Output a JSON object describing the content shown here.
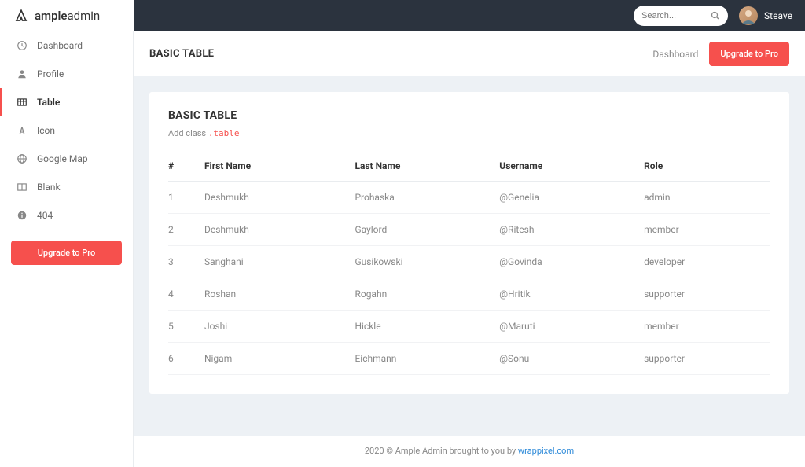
{
  "brand": {
    "name_bold": "ample",
    "name_light": "admin"
  },
  "search": {
    "placeholder": "Search..."
  },
  "user": {
    "name": "Steave"
  },
  "sidebar": {
    "items": [
      {
        "label": "Dashboard",
        "icon": "clock"
      },
      {
        "label": "Profile",
        "icon": "user"
      },
      {
        "label": "Table",
        "icon": "table",
        "active": true
      },
      {
        "label": "Icon",
        "icon": "font"
      },
      {
        "label": "Google Map",
        "icon": "globe"
      },
      {
        "label": "Blank",
        "icon": "columns"
      },
      {
        "label": "404",
        "icon": "info"
      }
    ],
    "upgrade_label": "Upgrade to Pro"
  },
  "header": {
    "title": "BASIC TABLE",
    "breadcrumb": "Dashboard",
    "upgrade_label": "Upgrade to Pro"
  },
  "card": {
    "title": "BASIC TABLE",
    "sub_prefix": "Add class ",
    "sub_code": ".table"
  },
  "table": {
    "columns": [
      "#",
      "First Name",
      "Last Name",
      "Username",
      "Role"
    ],
    "rows": [
      [
        "1",
        "Deshmukh",
        "Prohaska",
        "@Genelia",
        "admin"
      ],
      [
        "2",
        "Deshmukh",
        "Gaylord",
        "@Ritesh",
        "member"
      ],
      [
        "3",
        "Sanghani",
        "Gusikowski",
        "@Govinda",
        "developer"
      ],
      [
        "4",
        "Roshan",
        "Rogahn",
        "@Hritik",
        "supporter"
      ],
      [
        "5",
        "Joshi",
        "Hickle",
        "@Maruti",
        "member"
      ],
      [
        "6",
        "Nigam",
        "Eichmann",
        "@Sonu",
        "supporter"
      ]
    ]
  },
  "footer": {
    "text": "2020 © Ample Admin brought to you by ",
    "link_text": "wrappixel.com"
  }
}
